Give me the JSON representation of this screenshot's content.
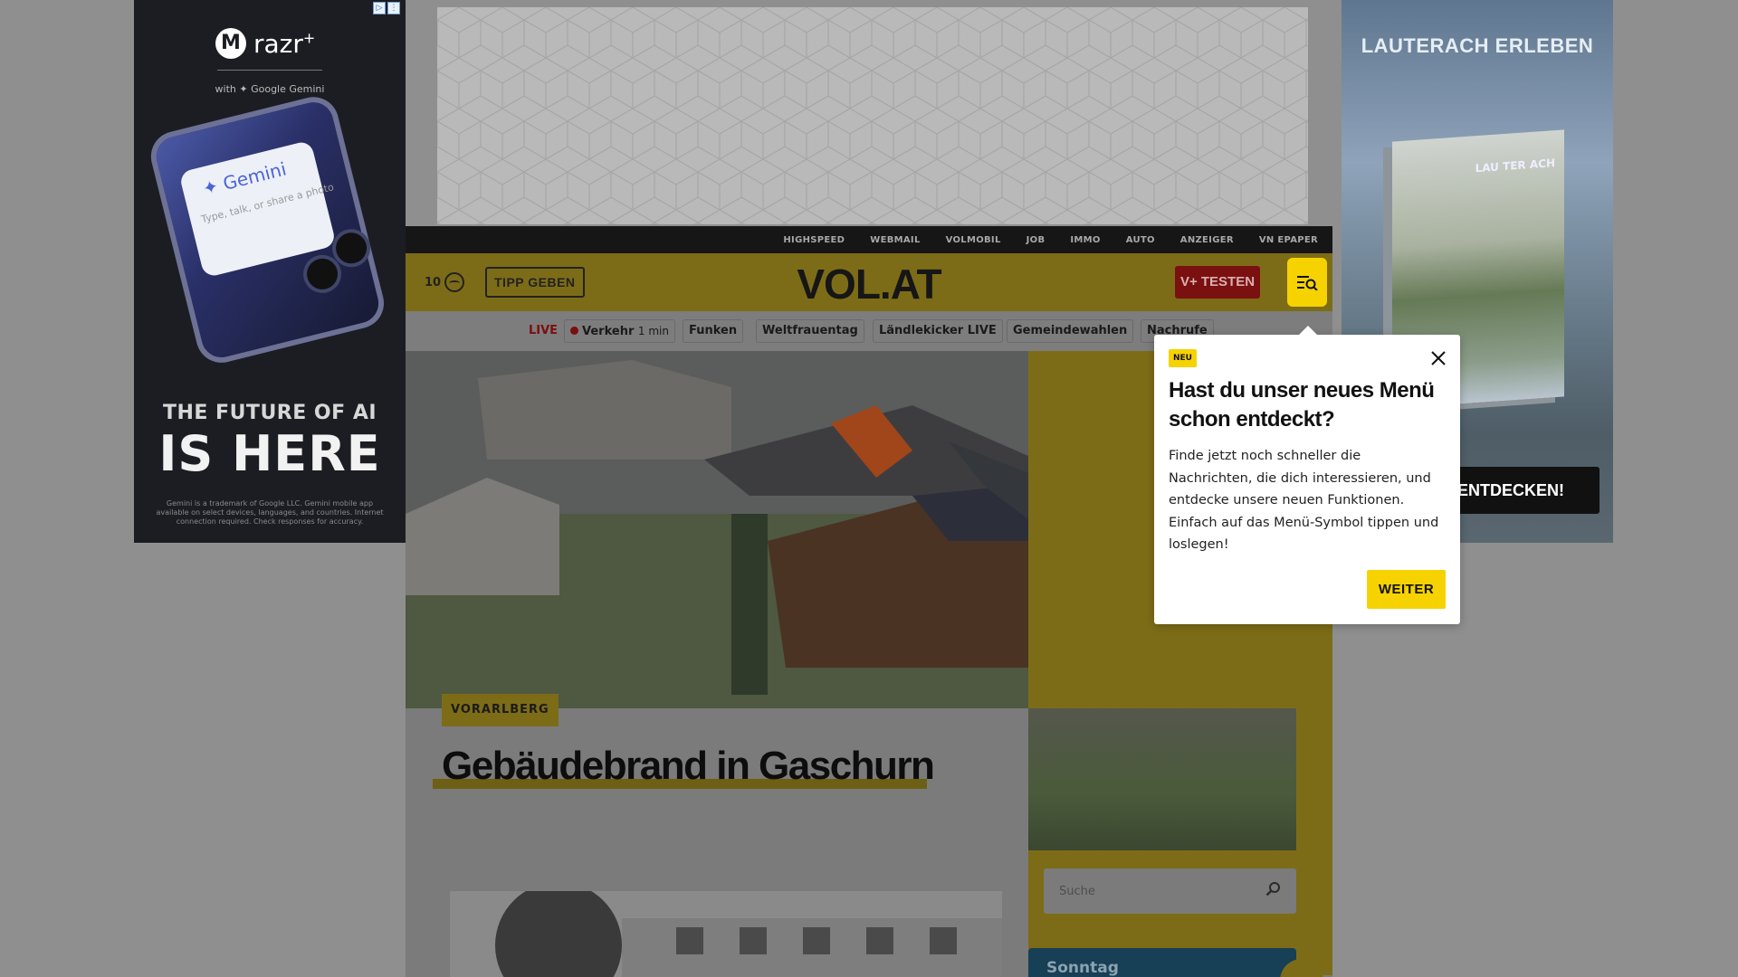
{
  "ads": {
    "left": {
      "brand": "razr",
      "brand_sup": "+",
      "with_text": "with ✦ Google Gemini",
      "gemini_label": "✦ Gemini",
      "prompt_text": "Type, talk, or share a photo",
      "tagline_1": "THE FUTURE OF AI",
      "tagline_2": "IS HERE",
      "fineprint": "Gemini is a trademark of Google LLC. Gemini mobile app available on select devices, languages, and countries. Internet connection required. Check responses for accuracy."
    },
    "right": {
      "title": "LAUTERACH ERLEBEN",
      "book_title": "LAU TER ACH",
      "cta": "ENTDECKEN!"
    }
  },
  "topnav": {
    "items": [
      "HIGHSPEED",
      "WEBMAIL",
      "VOLMOBIL",
      "JOB",
      "IMMO",
      "AUTO",
      "ANZEIGER",
      "VN EPAPER"
    ]
  },
  "header": {
    "temperature": "10",
    "tipp_label": "TIPP GEBEN",
    "logo": "VOL.AT",
    "vplus_label": "V+ TESTEN"
  },
  "subnav": {
    "live_label": "LIVE",
    "traffic_label": "Verkehr",
    "traffic_time": "1 min",
    "chips": [
      "Funken",
      "Weltfrauentag",
      "Ländlekicker LIVE",
      "Gemeindewahlen",
      "Nachrufe"
    ]
  },
  "article": {
    "rubric": "VORARLBERG",
    "headline": "Gebäudebrand in Gaschurn"
  },
  "sidebar": {
    "search_placeholder": "Suche",
    "sonntag_label": "Sonntag"
  },
  "popup": {
    "badge": "NEU",
    "title": "Hast du unser neues Menü schon entdeckt?",
    "body": "Finde jetzt noch schneller die Nachrichten, die dich interessieren, und entdecke unsere neuen Funktionen. Einfach auf das Menü-Symbol tippen und loslegen!",
    "button": "WEITER"
  }
}
